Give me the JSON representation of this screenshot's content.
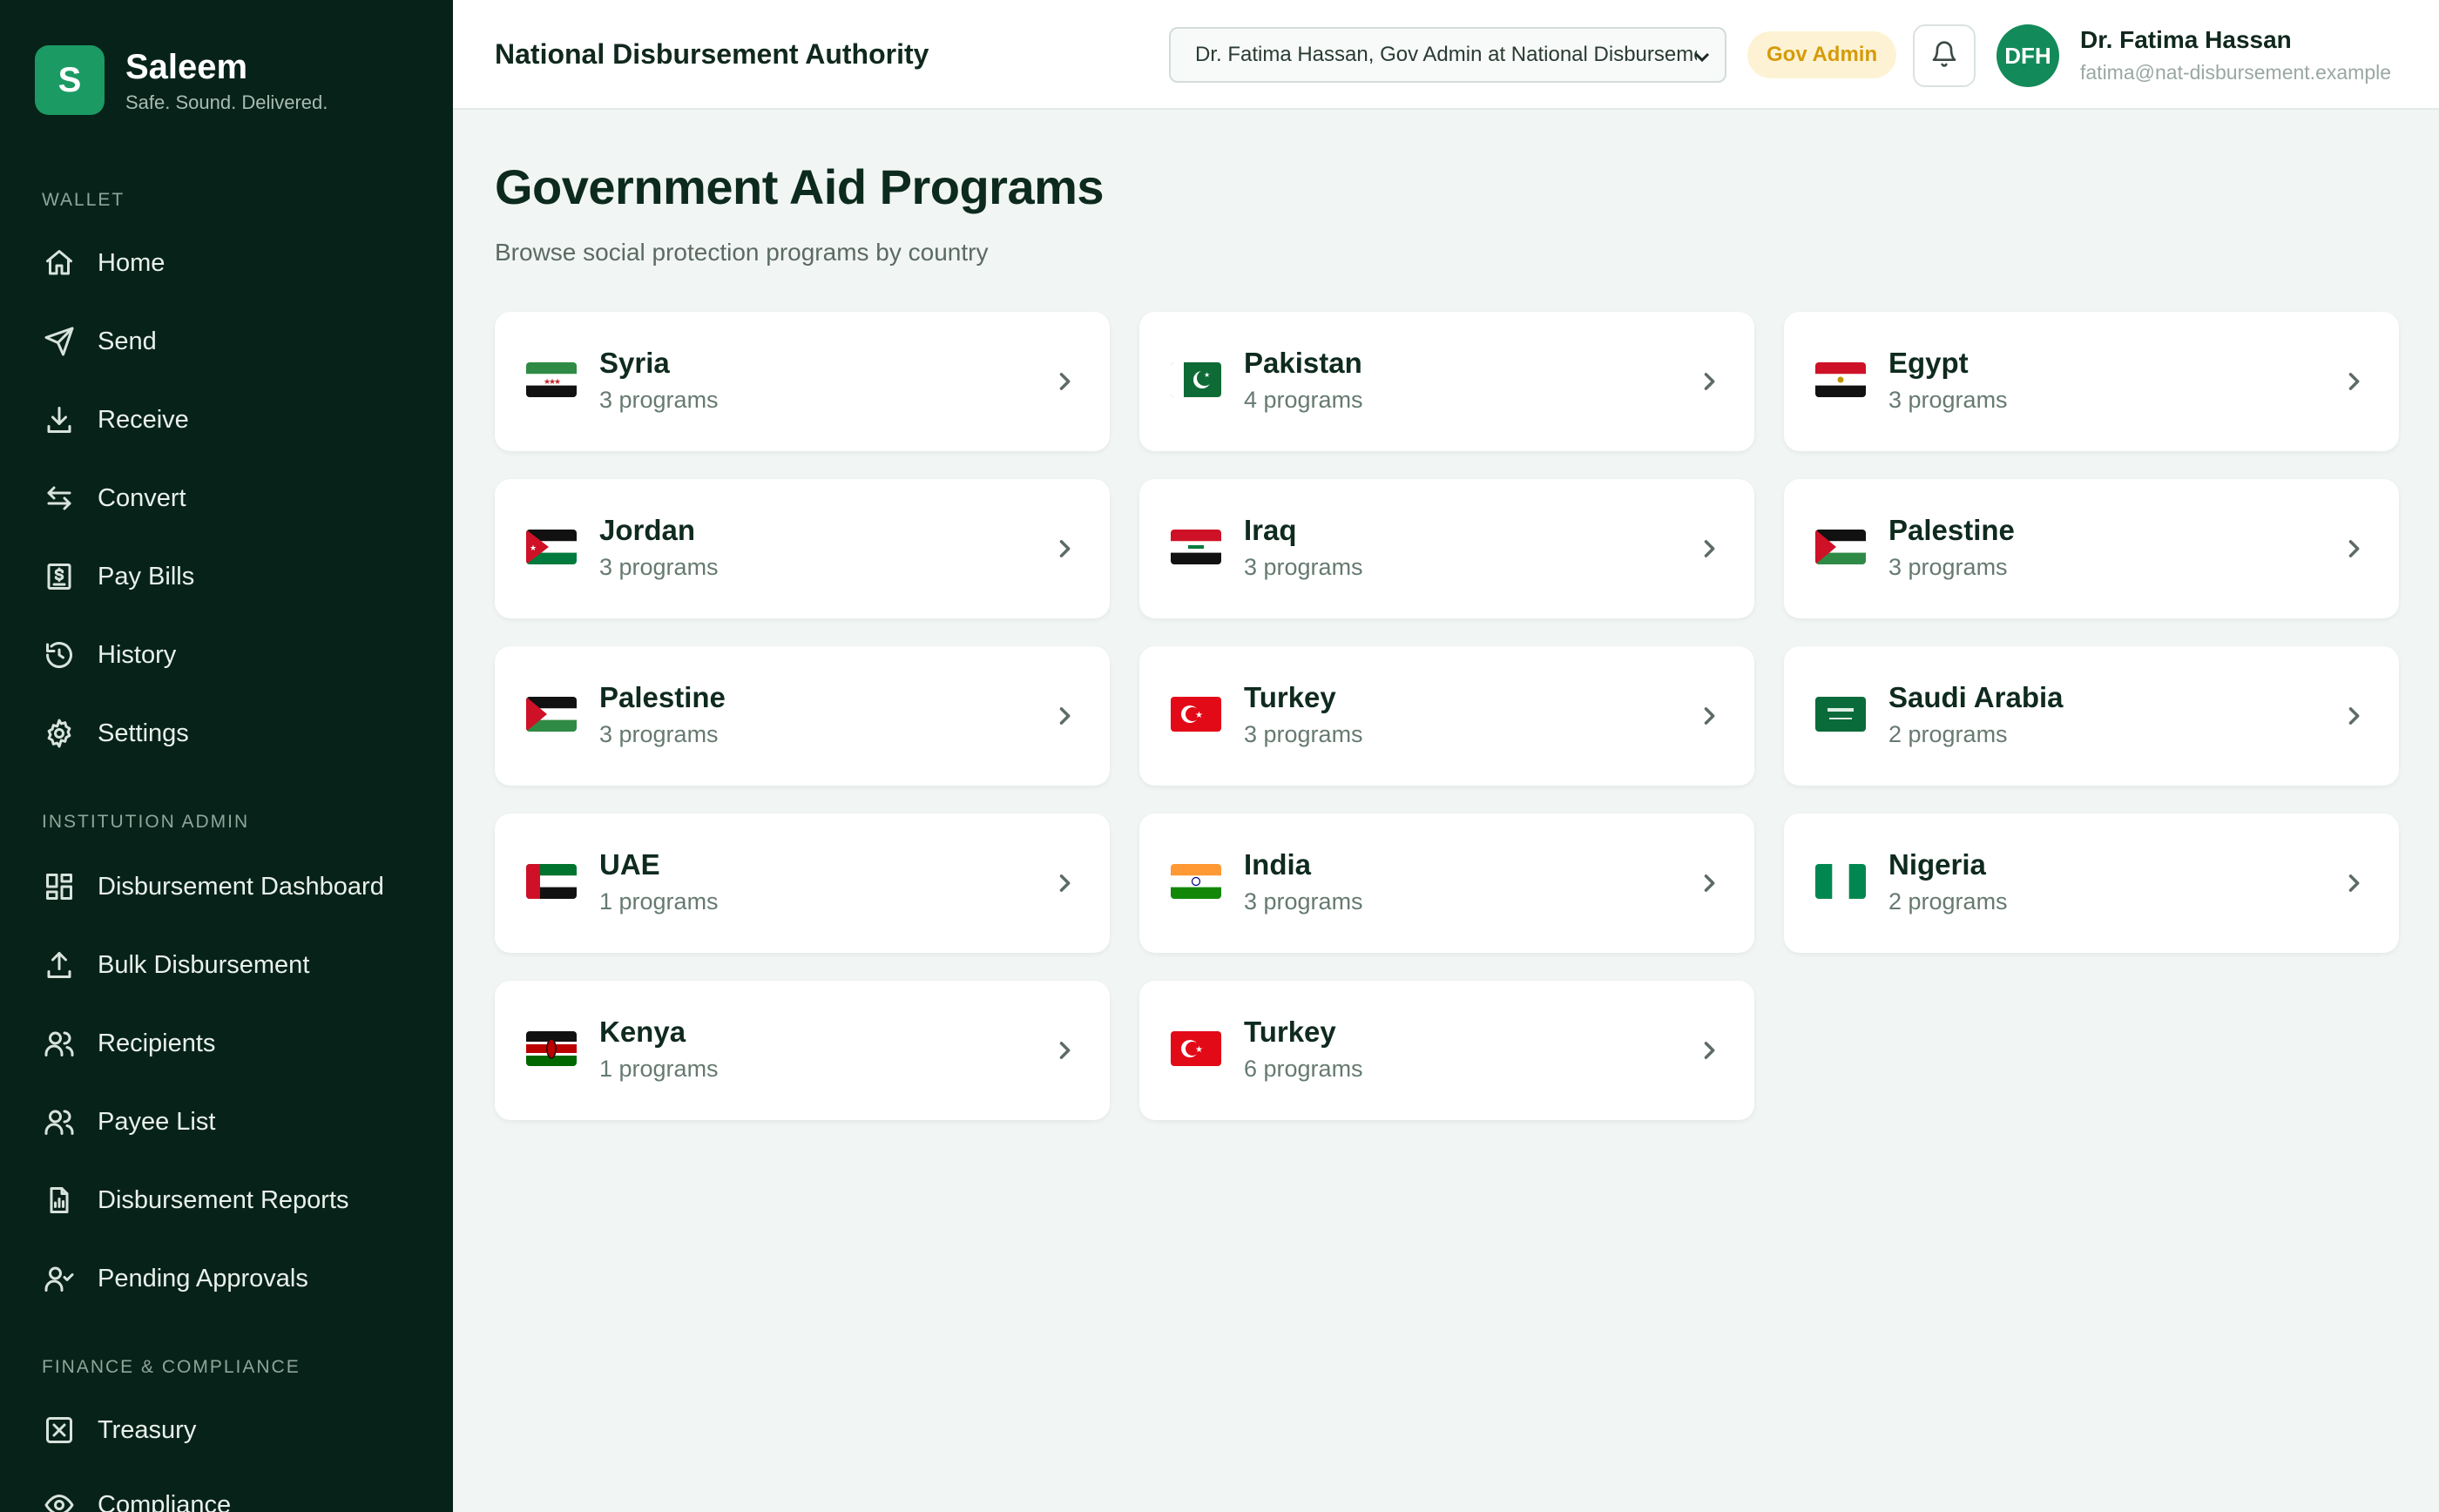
{
  "brand": {
    "logo_letter": "S",
    "name": "Saleem",
    "tagline": "Safe. Sound. Delivered."
  },
  "sidebar": {
    "sections": [
      {
        "label": "WALLET",
        "items": [
          {
            "label": "Home",
            "icon": "home-icon"
          },
          {
            "label": "Send",
            "icon": "send-icon"
          },
          {
            "label": "Receive",
            "icon": "download-icon"
          },
          {
            "label": "Convert",
            "icon": "convert-icon"
          },
          {
            "label": "Pay Bills",
            "icon": "bill-icon"
          },
          {
            "label": "History",
            "icon": "history-icon"
          },
          {
            "label": "Settings",
            "icon": "gear-icon"
          }
        ]
      },
      {
        "label": "INSTITUTION ADMIN",
        "items": [
          {
            "label": "Disbursement Dashboard",
            "icon": "dashboard-icon"
          },
          {
            "label": "Bulk Disbursement",
            "icon": "upload-icon"
          },
          {
            "label": "Recipients",
            "icon": "users-icon"
          },
          {
            "label": "Payee List",
            "icon": "users-icon"
          },
          {
            "label": "Disbursement Reports",
            "icon": "report-icon"
          },
          {
            "label": "Pending Approvals",
            "icon": "user-check-icon"
          }
        ]
      },
      {
        "label": "FINANCE & COMPLIANCE",
        "items": [
          {
            "label": "Treasury",
            "icon": "treasury-icon"
          },
          {
            "label": "Compliance",
            "icon": "eye-icon"
          }
        ]
      }
    ]
  },
  "header": {
    "title": "National Disbursement Authority",
    "org_select_value": "Dr. Fatima Hassan, Gov Admin at National Disbursement Authority",
    "role_badge": "Gov Admin",
    "user": {
      "initials": "DFH",
      "name": "Dr. Fatima Hassan",
      "email": "fatima@nat-disbursement.example"
    }
  },
  "main": {
    "title": "Government Aid Programs",
    "subtitle": "Browse social protection programs by country",
    "countries": [
      {
        "name": "Syria",
        "programs": "3 programs",
        "flag": "syria"
      },
      {
        "name": "Pakistan",
        "programs": "4 programs",
        "flag": "pakistan"
      },
      {
        "name": "Egypt",
        "programs": "3 programs",
        "flag": "egypt"
      },
      {
        "name": "Jordan",
        "programs": "3 programs",
        "flag": "jordan"
      },
      {
        "name": "Iraq",
        "programs": "3 programs",
        "flag": "iraq"
      },
      {
        "name": "Palestine",
        "programs": "3 programs",
        "flag": "palestine"
      },
      {
        "name": "Palestine",
        "programs": "3 programs",
        "flag": "palestine"
      },
      {
        "name": "Turkey",
        "programs": "3 programs",
        "flag": "turkey"
      },
      {
        "name": "Saudi Arabia",
        "programs": "2 programs",
        "flag": "saudi"
      },
      {
        "name": "UAE",
        "programs": "1 programs",
        "flag": "uae"
      },
      {
        "name": "India",
        "programs": "3 programs",
        "flag": "india"
      },
      {
        "name": "Nigeria",
        "programs": "2 programs",
        "flag": "nigeria"
      },
      {
        "name": "Kenya",
        "programs": "1 programs",
        "flag": "kenya"
      },
      {
        "name": "Turkey",
        "programs": "6 programs",
        "flag": "turkey"
      }
    ]
  },
  "colors": {
    "sidebar_bg": "#072219",
    "accent": "#1b9a63",
    "badge_text": "#d69a0a",
    "page_bg": "#f1f5f3"
  }
}
